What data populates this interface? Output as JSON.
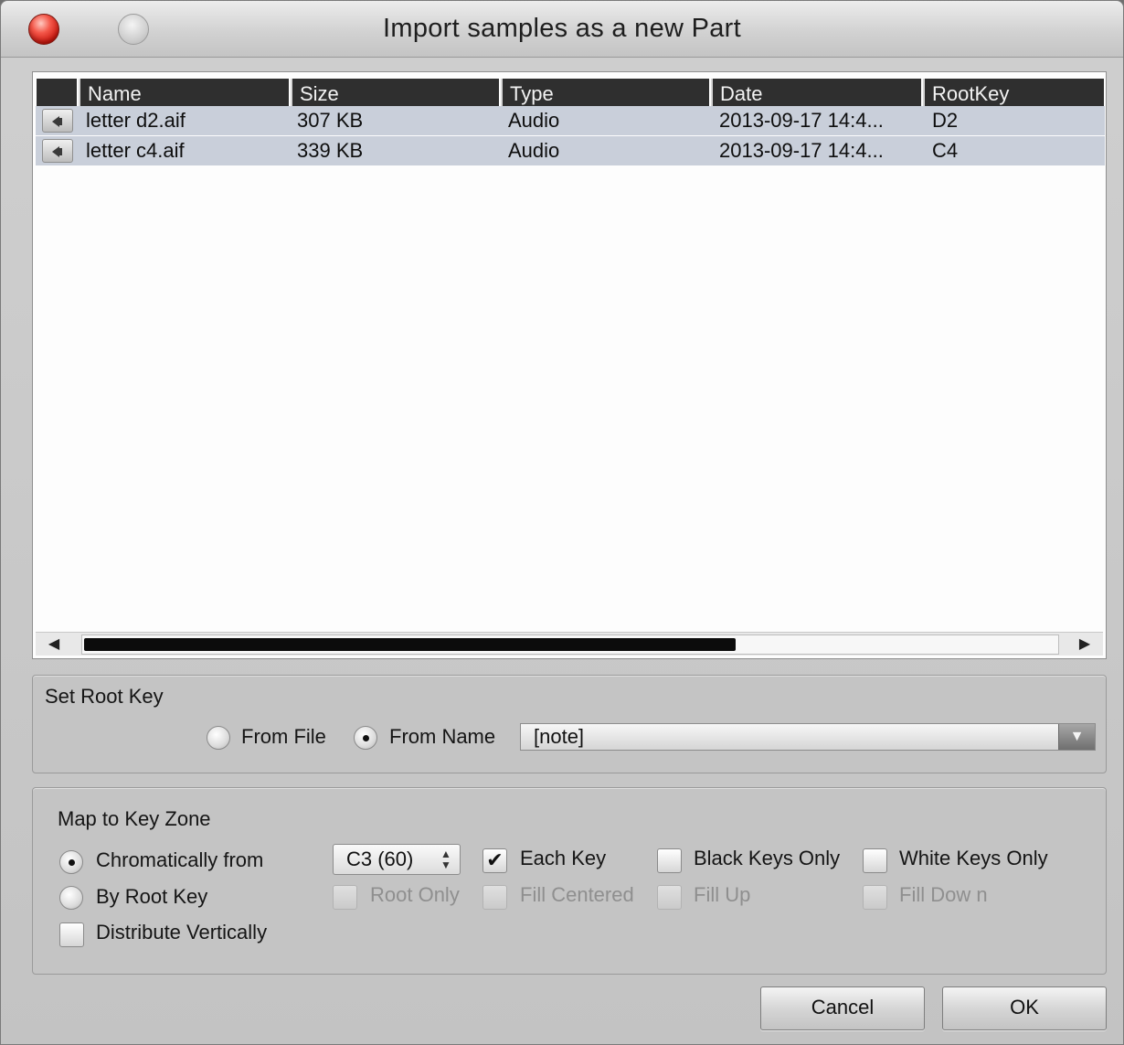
{
  "window": {
    "title": "Import samples as a new Part"
  },
  "table": {
    "columns": [
      "Name",
      "Size",
      "Type",
      "Date",
      "RootKey"
    ],
    "rows": [
      {
        "name": "letter d2.aif",
        "size": "307 KB",
        "type": "Audio",
        "date": "2013-09-17 14:4...",
        "rootkey": "D2"
      },
      {
        "name": "letter c4.aif",
        "size": "339 KB",
        "type": "Audio",
        "date": "2013-09-17 14:4...",
        "rootkey": "C4"
      }
    ],
    "scroll": {
      "left_arrow": "◀",
      "right_arrow": "▶",
      "thumb_fraction": 0.67
    }
  },
  "root_key": {
    "group_label": "Set Root Key",
    "from_file_label": "From File",
    "from_name_label": "From Name",
    "selected": "From Name",
    "pattern_value": "[note]"
  },
  "key_zone": {
    "group_label": "Map to Key Zone",
    "chromatically_label": "Chromatically from",
    "by_root_label": "By Root Key",
    "distribute_label": "Distribute Vertically",
    "start_note": "C3 (60)",
    "each_key_label": "Each Key",
    "black_keys_label": "Black Keys Only",
    "white_keys_label": "White Keys Only",
    "root_only_label": "Root Only",
    "fill_centered_label": "Fill Centered",
    "fill_up_label": "Fill Up",
    "fill_down_label": "Fill Dow n",
    "checkmark": "✔"
  },
  "buttons": {
    "cancel": "Cancel",
    "ok": "OK"
  },
  "icons": {
    "speaker": "speaker-icon",
    "dropdown": "▼",
    "spin": "▲▼"
  }
}
